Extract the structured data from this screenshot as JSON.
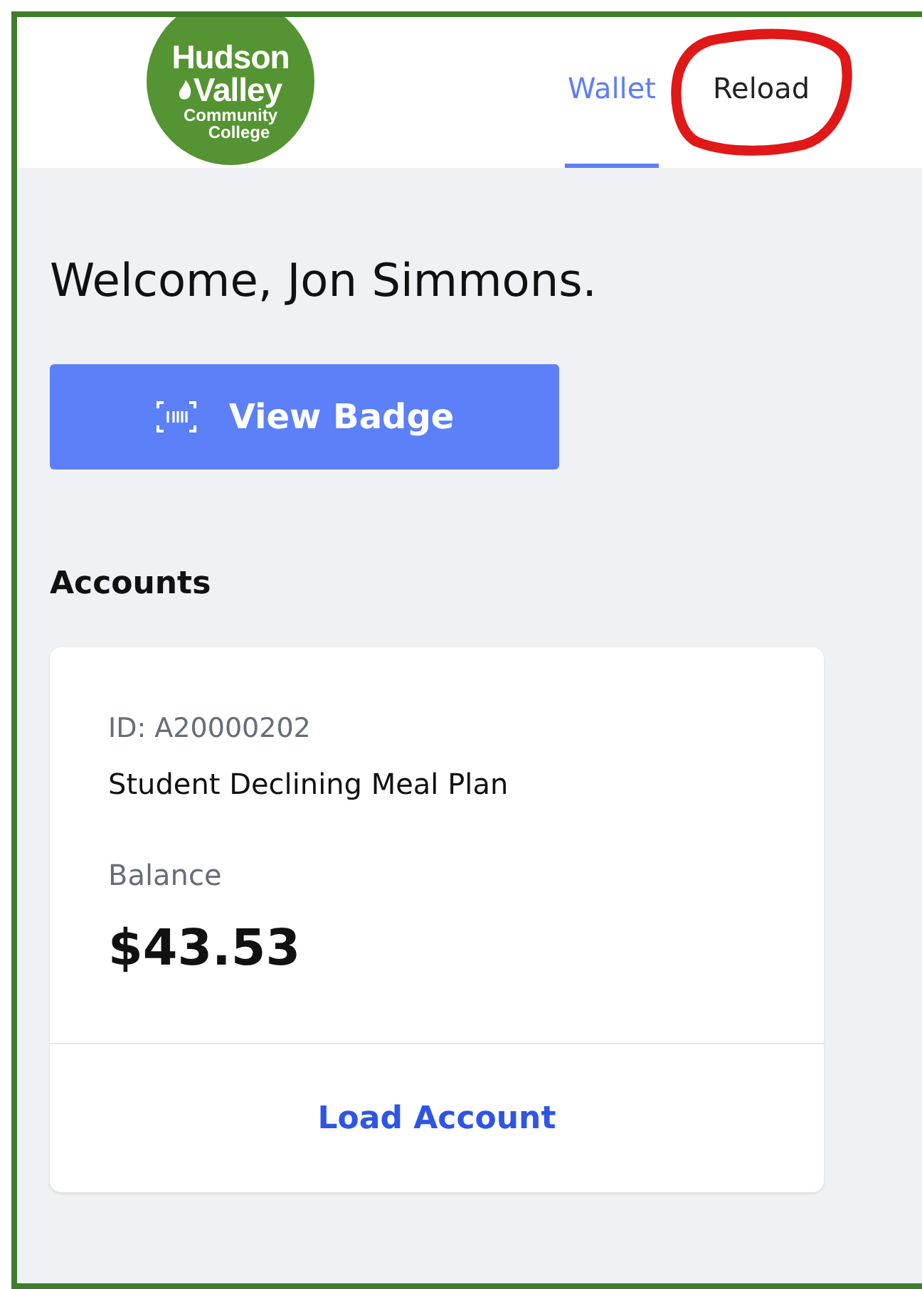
{
  "logo": {
    "lines": [
      "Hudson",
      "Valley",
      "Community",
      "College"
    ]
  },
  "tabs": [
    {
      "label": "Wallet",
      "selected": true,
      "circled": false
    },
    {
      "label": "Reload",
      "selected": false,
      "circled": true
    }
  ],
  "greeting": "Welcome, Jon Simmons.",
  "badge_button": {
    "label": "View Badge"
  },
  "accounts": {
    "heading": "Accounts",
    "cards": [
      {
        "id": "ID: A20000202",
        "name": "Student Declining Meal Plan",
        "balance_label": "Balance",
        "balance": "$43.53",
        "action": "Load Account"
      }
    ]
  }
}
